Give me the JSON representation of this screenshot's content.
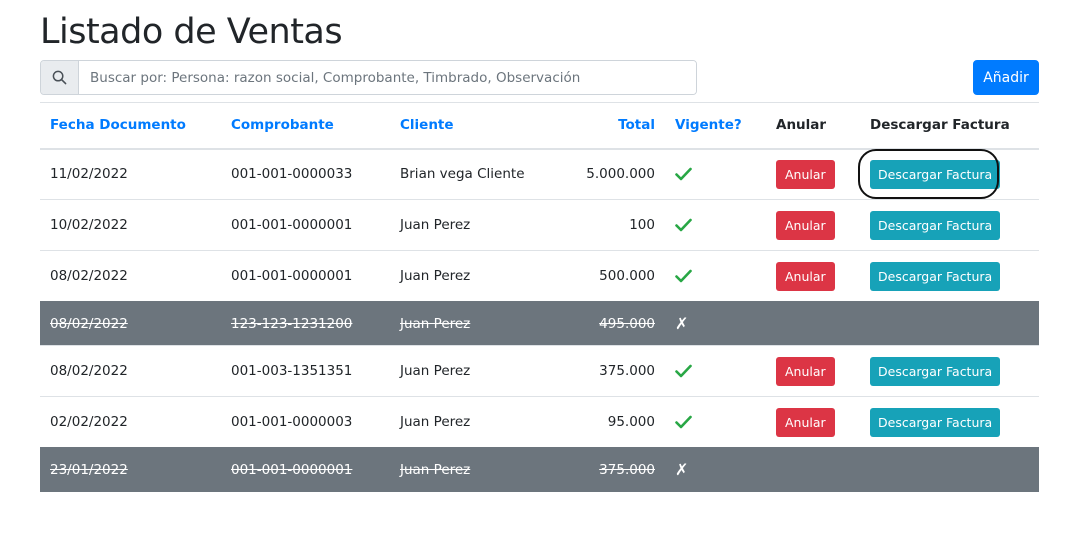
{
  "page": {
    "title": "Listado de Ventas"
  },
  "search": {
    "placeholder": "Buscar por: Persona: razon social, Comprobante, Timbrado, Observación",
    "value": ""
  },
  "toolbar": {
    "add_label": "Añadir"
  },
  "table": {
    "headers": {
      "fecha": "Fecha Documento",
      "comprobante": "Comprobante",
      "cliente": "Cliente",
      "total": "Total",
      "vigente": "Vigente?",
      "anular": "Anular",
      "descargar": "Descargar Factura"
    },
    "rows": [
      {
        "fecha": "11/02/2022",
        "comprobante": "001-001-0000033",
        "cliente": "Brian vega Cliente",
        "total": "5.000.000",
        "vigente": true,
        "anular_label": "Anular",
        "descargar_label": "Descargar Factura"
      },
      {
        "fecha": "10/02/2022",
        "comprobante": "001-001-0000001",
        "cliente": "Juan Perez",
        "total": "100",
        "vigente": true,
        "anular_label": "Anular",
        "descargar_label": "Descargar Factura"
      },
      {
        "fecha": "08/02/2022",
        "comprobante": "001-001-0000001",
        "cliente": "Juan Perez",
        "total": "500.000",
        "vigente": true,
        "anular_label": "Anular",
        "descargar_label": "Descargar Factura"
      },
      {
        "fecha": "08/02/2022",
        "comprobante": "123-123-1231200",
        "cliente": "Juan Perez",
        "total": "495.000",
        "vigente": false,
        "anular_label": "",
        "descargar_label": ""
      },
      {
        "fecha": "08/02/2022",
        "comprobante": "001-003-1351351",
        "cliente": "Juan Perez",
        "total": "375.000",
        "vigente": true,
        "anular_label": "Anular",
        "descargar_label": "Descargar Factura"
      },
      {
        "fecha": "02/02/2022",
        "comprobante": "001-001-0000003",
        "cliente": "Juan Perez",
        "total": "95.000",
        "vigente": true,
        "anular_label": "Anular",
        "descargar_label": "Descargar Factura"
      },
      {
        "fecha": "23/01/2022",
        "comprobante": "001-001-0000001",
        "cliente": "Juan Perez",
        "total": "375.000",
        "vigente": false,
        "anular_label": "",
        "descargar_label": ""
      }
    ]
  },
  "icons": {
    "vigente_true": "check-icon",
    "vigente_false": "cross-icon",
    "search": "search-icon"
  },
  "colors": {
    "primary": "#007bff",
    "danger": "#dc3545",
    "info": "#17a2b8",
    "void_row": "#6c757d",
    "check": "#28a745"
  }
}
